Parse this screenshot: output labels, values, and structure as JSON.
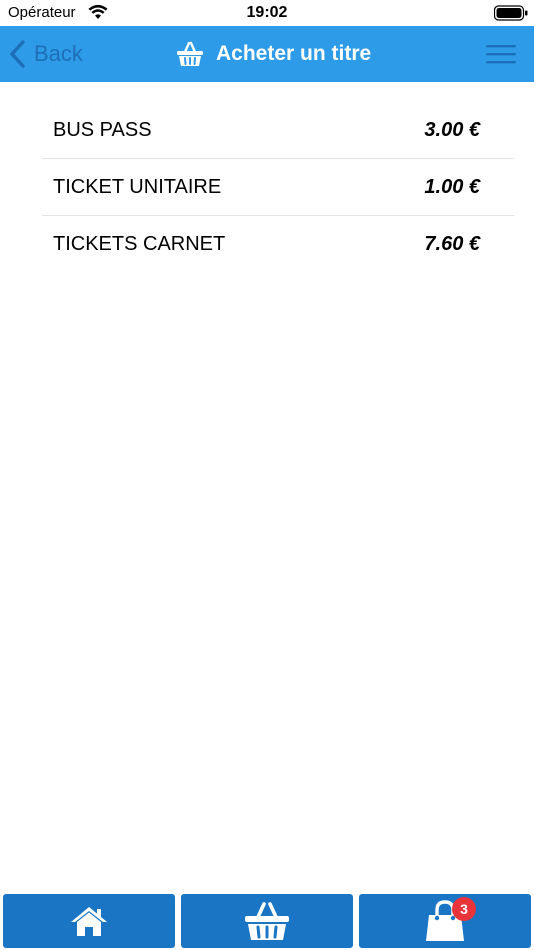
{
  "status_bar": {
    "carrier": "Opérateur",
    "time": "19:02",
    "icons": [
      "wifi-icon",
      "battery-icon"
    ]
  },
  "nav": {
    "back_label": "Back",
    "title": "Acheter un titre",
    "title_icon": "basket-icon",
    "menu_icon": "hamburger-menu-icon",
    "accent_color": "#2d9be8"
  },
  "tickets": [
    {
      "name": "BUS PASS",
      "price": "3.00 €"
    },
    {
      "name": "TICKET UNITAIRE",
      "price": "1.00 €"
    },
    {
      "name": "TICKETS CARNET",
      "price": "7.60 €"
    }
  ],
  "tab_bar": {
    "tabs": [
      {
        "icon": "home-icon"
      },
      {
        "icon": "basket-icon"
      },
      {
        "icon": "shopping-bag-icon",
        "badge": "3"
      }
    ],
    "tab_color": "#1a76c4",
    "badge_color": "#e8343a"
  }
}
